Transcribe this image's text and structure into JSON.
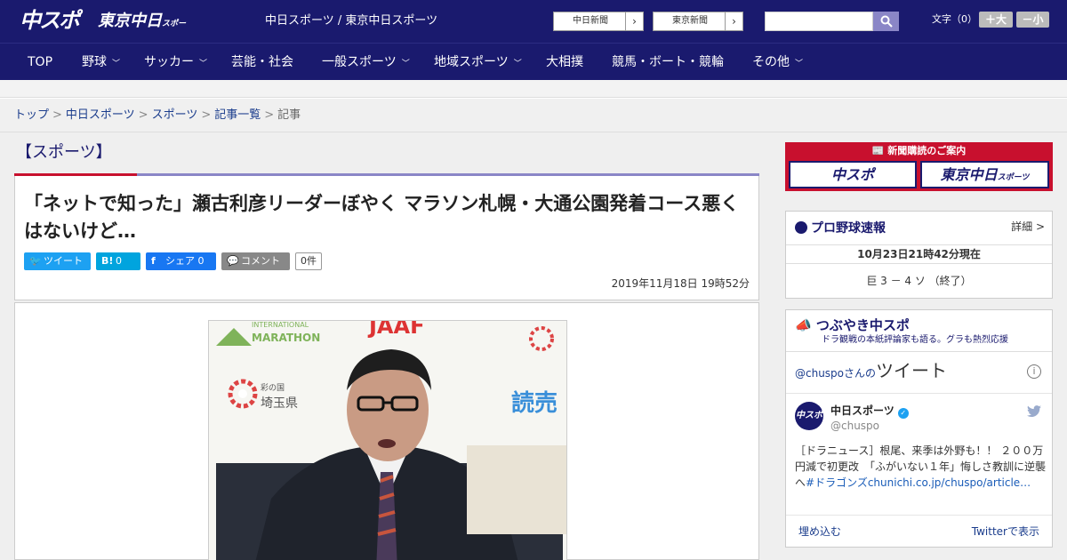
{
  "header": {
    "logo_chuspo": "中スポ",
    "logo_tokyo": "東京中日",
    "logo_tokyo_small": "スポーツ",
    "site_title": "中日スポーツ / 東京中日スポーツ",
    "link_chunichi": "中日新聞",
    "link_tokyo": "東京新聞",
    "arrow": "›",
    "search_placeholder": "",
    "font_label": "文字（0）",
    "font_up": "＋大",
    "font_down": "－小"
  },
  "nav": {
    "items": [
      {
        "label": "TOP",
        "has_menu": false
      },
      {
        "label": "野球",
        "has_menu": true
      },
      {
        "label": "サッカー",
        "has_menu": true
      },
      {
        "label": "芸能・社会",
        "has_menu": false
      },
      {
        "label": "一般スポーツ",
        "has_menu": true
      },
      {
        "label": "地域スポーツ",
        "has_menu": true
      },
      {
        "label": "大相撲",
        "has_menu": false
      },
      {
        "label": "競馬・ボート・競輪",
        "has_menu": false
      },
      {
        "label": "その他",
        "has_menu": true
      }
    ]
  },
  "breadcrumb": {
    "items": [
      "トップ",
      "中日スポーツ",
      "スポーツ",
      "記事一覧"
    ],
    "current": "記事",
    "separator": ">"
  },
  "article": {
    "section": "【スポーツ】",
    "title": "「ネットで知った」瀬古利彦リーダーぼやく マラソン札幌・大通公園発着コース悪くはないけど…",
    "share": {
      "tweet": "ツイート",
      "hatena_icon": "B!",
      "hatena_count": "0",
      "facebook": "シェア 0",
      "comment": "コメント",
      "comment_count": "0件"
    },
    "date": "2019年11月18日 19時52分",
    "photo_texts": {
      "marathon_small": "INTERNATIONAL",
      "marathon": "MARATHON",
      "jaaf": "JAAF",
      "saitama_small": "彩の国",
      "saitama": "埼玉県",
      "yomiuri": "読売"
    }
  },
  "sidebar": {
    "subscribe": {
      "label": "新聞購読のご案内",
      "chuspo": "中スポ",
      "tokyo": "東京中日",
      "tokyo_small": "スポーツ"
    },
    "baseball": {
      "title": "プロ野球速報",
      "detail": "詳細 >",
      "time": "10月23日21時42分現在",
      "score_line": "巨 3 － 4 ソ （終了）"
    },
    "tweets": {
      "title": "つぶやき中スポ",
      "subtitle": "ドラ観戦の本紙評論家も語る。グラも熱烈応援",
      "timeline_prefix": "@chuspoさんの",
      "timeline_title": "ツイート",
      "info": "i",
      "avatar": "中スポ",
      "name": "中日スポーツ",
      "verified": "✓",
      "handle": "@chuspo",
      "text_plain": "［ドラニュース］根尾、来季は外野も！！ ２００万円減で初更改　「ふがいない１年」悔しさ教訓に逆襲へ",
      "text_link": "#ドラゴンズchunichi.co.jp/chuspo/article…",
      "embed": "埋め込む",
      "view_on_twitter": "Twitterで表示"
    }
  },
  "colors": {
    "brand_navy": "#1a1a6e",
    "accent_red": "#c8102e",
    "accent_lavender": "#8a86c7",
    "twitter_blue": "#1da1f2",
    "hatena_blue": "#00a4de",
    "facebook_blue": "#1877f2"
  }
}
